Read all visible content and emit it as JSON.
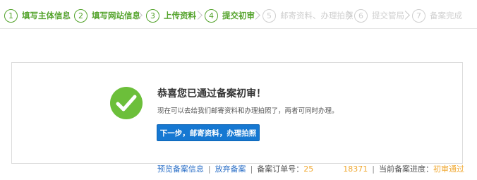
{
  "steps": [
    {
      "num": "1",
      "label": "填写主体信息",
      "state": "done"
    },
    {
      "num": "2",
      "label": "填写网站信息",
      "state": "done"
    },
    {
      "num": "3",
      "label": "上传资料",
      "state": "done"
    },
    {
      "num": "4",
      "label": "提交初审",
      "state": "done"
    },
    {
      "num": "5",
      "label": "邮寄资料、办理拍照",
      "state": "pending"
    },
    {
      "num": "6",
      "label": "提交管局",
      "state": "pending"
    },
    {
      "num": "7",
      "label": "备案完成",
      "state": "pending"
    }
  ],
  "result": {
    "icon": "check-circle-icon",
    "title": "恭喜您已通过备案初审！",
    "desc": "现在可以去给我们邮寄资料和办理拍照了，两者可同时办理。",
    "button": "下一步，邮寄资料，办理拍照"
  },
  "footer": {
    "preview_link": "预览备案信息",
    "abandon_link": "放弃备案",
    "order_label": "备案订单号：",
    "order_prefix": "25",
    "order_suffix": "18371",
    "progress_label": "当前备案进度：",
    "progress_value": "初审通过"
  },
  "colors": {
    "done_green": "#53a32b",
    "pending_gray": "#cfcfcf",
    "button_blue": "#1678d2",
    "link_blue": "#2f72c8",
    "highlight_orange": "#f0a830",
    "success_green": "#6cbf3a"
  }
}
